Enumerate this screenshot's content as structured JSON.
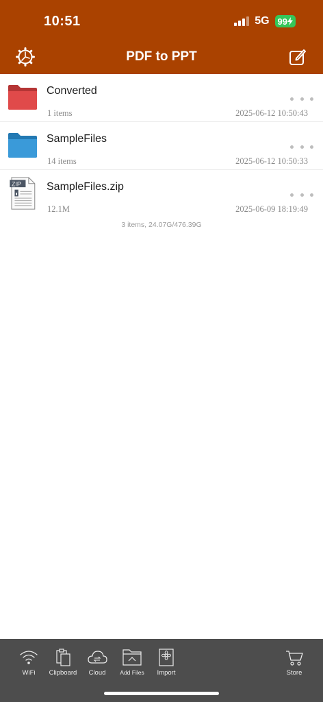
{
  "status": {
    "time": "10:51",
    "network": "5G",
    "battery": "99"
  },
  "nav": {
    "title": "PDF to PPT"
  },
  "files": [
    {
      "name": "Converted",
      "meta": "1 items",
      "date": "2025-06-12 10:50:43",
      "icon": "folder-red-icon"
    },
    {
      "name": "SampleFiles",
      "meta": "14 items",
      "date": "2025-06-12 10:50:33",
      "icon": "folder-blue-icon"
    },
    {
      "name": "SampleFiles.zip",
      "meta": "12.1M",
      "date": "2025-06-09 18:19:49",
      "icon": "zip-file-icon"
    }
  ],
  "summary": "3 items, 24.07G/476.39G",
  "toolbar": {
    "wifi": "WiFi",
    "clipboard": "Clipboard",
    "cloud": "Cloud",
    "add_files": "Add Files",
    "import": "Import",
    "store": "Store"
  },
  "colors": {
    "header": "#aa4200",
    "toolbar": "#4d4d4d",
    "folder_red": "#e04a4a",
    "folder_blue": "#3a9ad9",
    "battery": "#34c759"
  },
  "zip_label": "ZIP"
}
